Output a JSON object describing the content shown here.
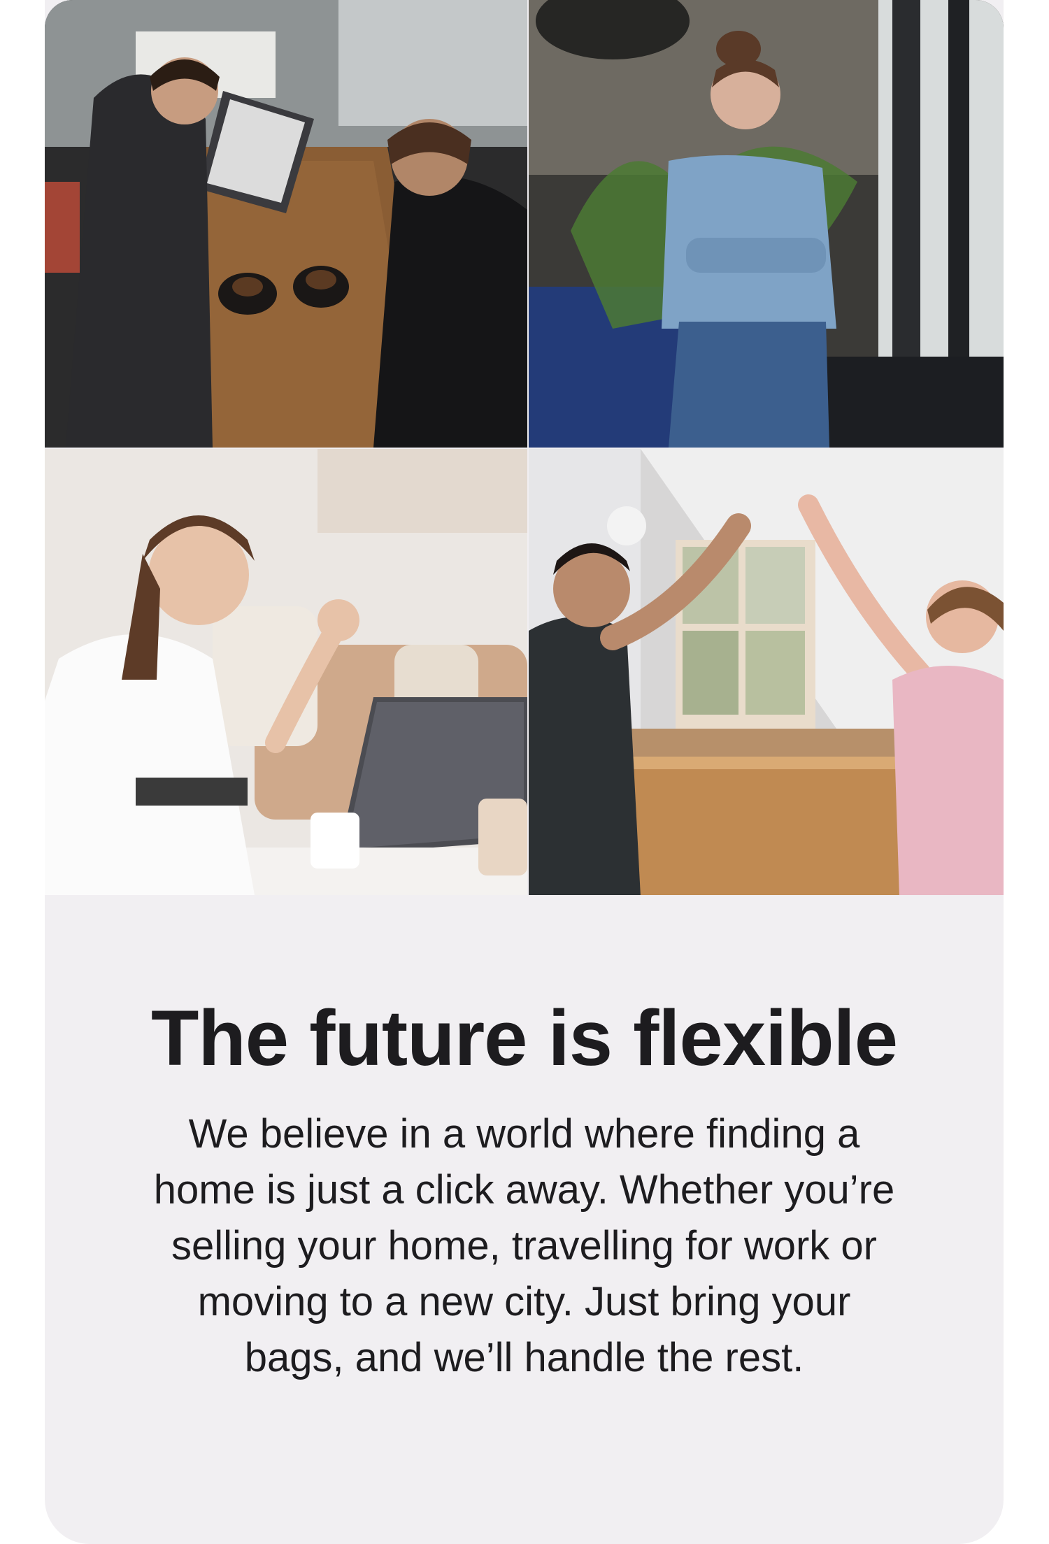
{
  "images": [
    {
      "name": "two-men-working-at-cafe-table-with-laptop"
    },
    {
      "name": "woman-in-denim-shirt-looking-out-window"
    },
    {
      "name": "woman-on-video-call-at-laptop"
    },
    {
      "name": "couple-high-five-over-moving-box"
    }
  ],
  "promo": {
    "headline": "The future is flexible",
    "body": "We believe in a world where finding a home is just a click away. Whether you’re selling your home, travelling for work or moving to a new city.  Just bring your bags, and we’ll handle the rest."
  },
  "colors": {
    "card_background": "#f1eff2",
    "text": "#1d1c1f"
  }
}
